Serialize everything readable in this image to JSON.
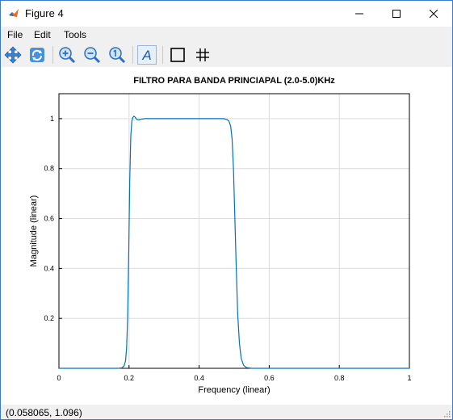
{
  "window": {
    "title": "Figure 4",
    "controls": {
      "minimize": "minimize-icon",
      "maximize": "maximize-icon",
      "close": "close-icon"
    }
  },
  "menubar": {
    "items": [
      "File",
      "Edit",
      "Tools"
    ]
  },
  "toolbar": {
    "icons": [
      "pan-icon",
      "rotate-icon",
      "zoom-in-icon",
      "zoom-out-icon",
      "reset-view-icon",
      "text-icon",
      "box-icon",
      "grid-icon"
    ],
    "text_icon_glyph": "A"
  },
  "status": {
    "coords": "(0.058065, 1.096)"
  },
  "chart_data": {
    "type": "line",
    "title": "FILTRO PARA BANDA PRINCIAPAL (2.0-5.0)KHz",
    "xlabel": "Frequency (linear)",
    "ylabel": "Magnitude (linear)",
    "xlim": [
      0,
      1
    ],
    "ylim": [
      0,
      1.1
    ],
    "xticks": [
      0,
      0.2,
      0.4,
      0.6,
      0.8,
      1
    ],
    "xtick_labels": [
      "0",
      "0.2",
      "0.4",
      "0.6",
      "0.8",
      "1"
    ],
    "yticks": [
      0.2,
      0.4,
      0.6,
      0.8,
      1
    ],
    "ytick_labels": [
      "0.2",
      "0.4",
      "0.6",
      "0.8",
      "1"
    ],
    "grid": true,
    "line_color": "#0072bd",
    "x": [
      0,
      0.17,
      0.18,
      0.186,
      0.19,
      0.193,
      0.196,
      0.199,
      0.202,
      0.205,
      0.208,
      0.211,
      0.214,
      0.218,
      0.222,
      0.228,
      0.235,
      0.245,
      0.26,
      0.3,
      0.4,
      0.47,
      0.48,
      0.485,
      0.49,
      0.494,
      0.498,
      0.502,
      0.506,
      0.51,
      0.515,
      0.52,
      0.527,
      0.535,
      0.55,
      0.6,
      0.8,
      1
    ],
    "y": [
      0,
      0,
      0.002,
      0.01,
      0.03,
      0.08,
      0.2,
      0.45,
      0.75,
      0.93,
      0.99,
      1.005,
      1.01,
      1.005,
      0.997,
      0.995,
      0.998,
      1.0,
      1.0,
      1.0,
      1.0,
      1.0,
      0.996,
      0.99,
      0.97,
      0.92,
      0.8,
      0.6,
      0.4,
      0.22,
      0.1,
      0.04,
      0.012,
      0.003,
      0.0,
      0,
      0,
      0
    ]
  }
}
